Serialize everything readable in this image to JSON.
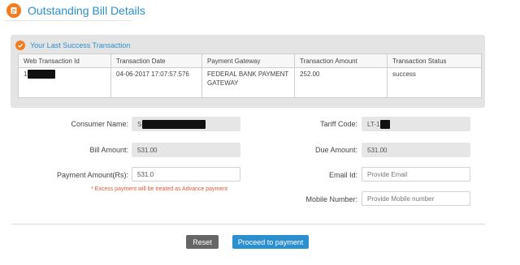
{
  "header": {
    "title": "Outstanding Bill Details",
    "icon": "bill-icon",
    "accent": "#f47c20",
    "title_color": "#2b8fd0"
  },
  "last_transaction": {
    "title": "Your Last Success Transaction",
    "columns": [
      "Web Transaction Id",
      "Transaction Date",
      "Payment Gateway",
      "Transaction Amount",
      "Transaction Status"
    ],
    "row": {
      "web_transaction_id": "1",
      "transaction_date": "04-06-2017 17:07:57.576",
      "payment_gateway": "FEDERAL BANK PAYMENT GATEWAY",
      "transaction_amount": "252.00",
      "transaction_status": "success"
    }
  },
  "form": {
    "consumer_name_label": "Consumer Name:",
    "consumer_name_value": "S",
    "tariff_code_label": "Tariff Code:",
    "tariff_code_value": "LT-1",
    "bill_amount_label": "Bill Amount:",
    "bill_amount_value": "531.00",
    "due_amount_label": "Due Amount:",
    "due_amount_value": "531.00",
    "payment_amount_label": "Payment Amount(Rs):",
    "payment_amount_value": "531.0",
    "email_label": "Email Id:",
    "email_placeholder": "Provide Email",
    "mobile_label": "Mobile Number:",
    "mobile_placeholder": "Provide Mobile number",
    "excess_note": "* Excess payment will be treated as Advance payment"
  },
  "buttons": {
    "reset_label": "Reset",
    "pay_label": "Proceed to payment",
    "reset_color": "#666666",
    "pay_color": "#2b8fd0"
  }
}
